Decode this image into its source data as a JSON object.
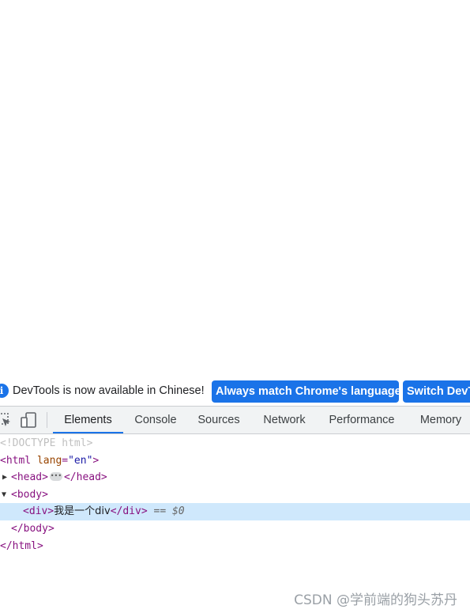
{
  "infobar": {
    "message": "DevTools is now available in Chinese!",
    "always_match_label": "Always match Chrome's language",
    "switch_label": "Switch DevTools to Chinese",
    "info_icon": "i"
  },
  "tabs": [
    "Elements",
    "Console",
    "Sources",
    "Network",
    "Performance",
    "Memory"
  ],
  "dom": {
    "doctype": "<!DOCTYPE html>",
    "html_open_tag": "<html",
    "html_attr": " lang",
    "html_eq": "=",
    "html_val": "\"en\"",
    "html_open_close": ">",
    "head_open": "<head>",
    "head_close": "</head>",
    "body_open": "<body>",
    "div_open": "<div>",
    "div_text": "我是一个div",
    "div_close": "</div>",
    "selected_marker": " == ",
    "selected_var": "$0",
    "body_close": "</body>",
    "html_close": "</html>"
  },
  "watermark": "CSDN @学前端的狗头苏丹",
  "colors": {
    "accent": "#1a73e8",
    "selected_row": "#cfe8fc",
    "tag": "#881280",
    "attr": "#994500",
    "value": "#1a1aa6"
  }
}
